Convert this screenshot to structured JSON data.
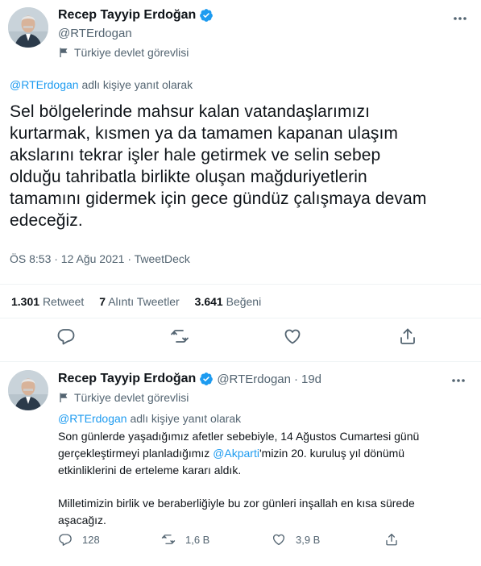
{
  "colors": {
    "text": "#0f1419",
    "secondary": "#536471",
    "accent": "#1d9bf0",
    "divider": "#eff3f4"
  },
  "main_tweet": {
    "display_name": "Recep Tayyip Erdoğan",
    "handle": "@RTErdogan",
    "account_label": "Türkiye devlet görevlisi",
    "reply_context": {
      "mention": "@RTErdogan",
      "suffix": " adlı kişiye yanıt olarak"
    },
    "text_lines": [
      "Sel bölgelerinde mahsur kalan vatandaşlarımızı",
      "kurtarmak, kısmen ya da tamamen kapanan ulaşım",
      "akslarını tekrar işler hale getirmek ve selin sebep",
      "olduğu tahribatla birlikte oluşan mağduriyetlerin",
      "tamamını gidermek için gece gündüz çalışmaya devam",
      "edeceğiz."
    ],
    "meta": "ÖS 8:53 · 12 Ağu 2021 · TweetDeck",
    "stats": {
      "retweets": {
        "value": "1.301",
        "label": "Retweet"
      },
      "quotes": {
        "value": "7",
        "label": "Alıntı Tweetler"
      },
      "likes": {
        "value": "3.641",
        "label": "Beğeni"
      }
    },
    "icons": [
      "verified-icon",
      "flag-icon",
      "more-icon",
      "reply-icon",
      "retweet-icon",
      "like-icon",
      "share-icon"
    ]
  },
  "reply_tweet": {
    "display_name": "Recep Tayyip Erdoğan",
    "handle": "@RTErdogan",
    "separator": "·",
    "time": "19d",
    "account_label": "Türkiye devlet görevlisi",
    "reply_context": {
      "mention": "@RTErdogan",
      "suffix": " adlı kişiye yanıt olarak"
    },
    "paragraph1": {
      "line1": "Son günlerde yaşadığımız afetler sebebiyle, 14 Ağustos Cumartesi günü",
      "line2_before": "gerçekleştirmeyi planladığımız ",
      "line2_mention": "@Akparti",
      "line2_after": "'mizin 20. kuruluş yıl dönümü",
      "line3": "etkinliklerini de erteleme kararı aldık."
    },
    "paragraph2": {
      "line1": "Milletimizin birlik ve beraberliğiyle bu zor günleri inşallah en kısa sürede",
      "line2": "aşacağız."
    },
    "counts": {
      "replies": "128",
      "retweets": "1,6 B",
      "likes": "3,9 B"
    }
  }
}
